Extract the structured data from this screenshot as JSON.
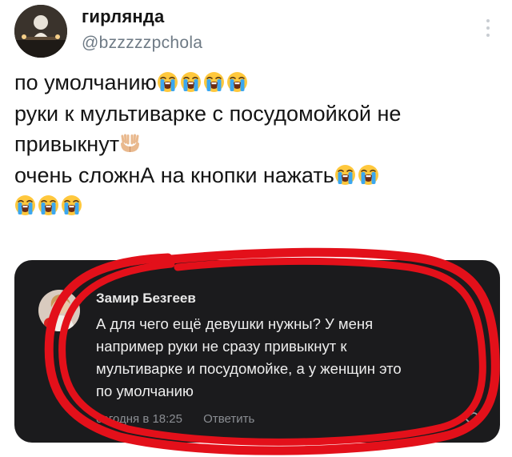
{
  "tweet": {
    "author": {
      "display_name": "гирлянда",
      "handle": "@bzzzzzpchola"
    },
    "more_icon": "vertical-ellipsis-icon",
    "lines": [
      {
        "text": "по умолчанию",
        "emoji": [
          "loudly-crying-face",
          "loudly-crying-face",
          "loudly-crying-face",
          "loudly-crying-face"
        ]
      },
      {
        "text": "руки к мультиварке с посудомойкой не",
        "emoji": []
      },
      {
        "text": "привыкнут",
        "emoji": [
          "palms-up-together"
        ]
      },
      {
        "text": "очень сложнА на кнопки нажать",
        "emoji": [
          "loudly-crying-face",
          "loudly-crying-face"
        ]
      },
      {
        "text": "",
        "emoji": [
          "loudly-crying-face",
          "loudly-crying-face",
          "loudly-crying-face"
        ]
      }
    ]
  },
  "comment": {
    "author": "Замир Безгеев",
    "text_lines": [
      "А для чего ещё девушки нужны? У меня",
      "например руки не сразу привыкнут к",
      "мультиварке и посудомойке, а у женщин это",
      "по умолчанию"
    ],
    "timestamp": "сегодня в 18:25",
    "reply_label": "Ответить",
    "like_icon": "heart-outline-icon",
    "highlight_color": "#e3101a",
    "card_background": "#1b1b1d"
  }
}
